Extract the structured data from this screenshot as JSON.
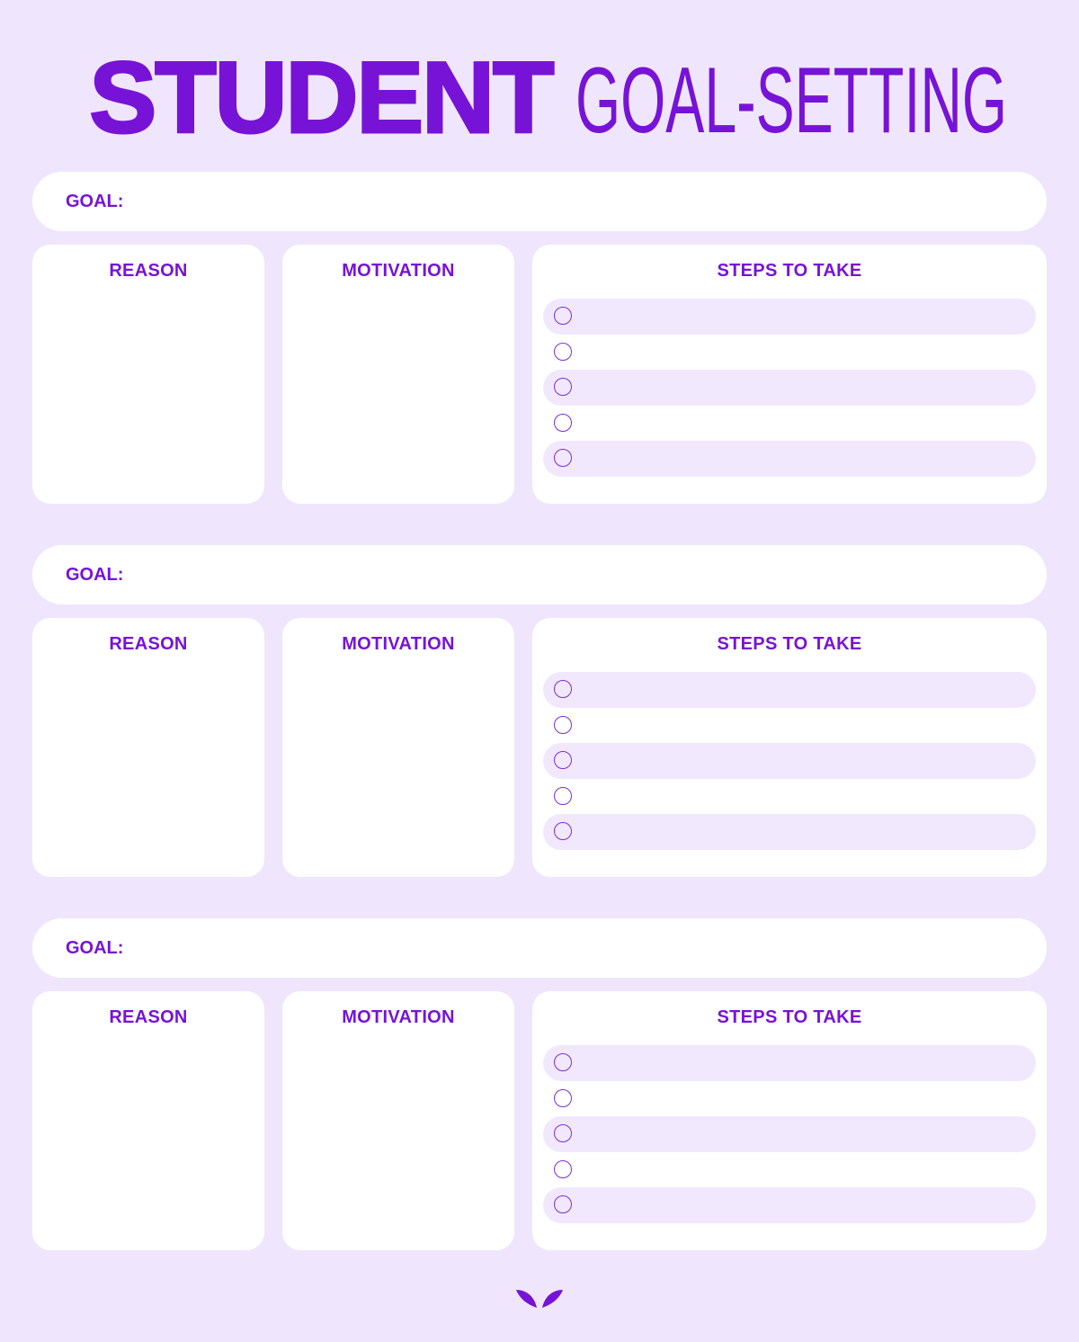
{
  "title": {
    "bold": "STUDENT",
    "light": "GOAL-SETTING"
  },
  "colors": {
    "accent": "#7713d6",
    "background": "#efe6fd",
    "card": "#ffffff",
    "row_shade": "#f1e8fd"
  },
  "sections": [
    {
      "goal_label": "GOAL:",
      "reason_label": "REASON",
      "motivation_label": "MOTIVATION",
      "steps_label": "STEPS TO TAKE",
      "steps": [
        "",
        "",
        "",
        "",
        ""
      ]
    },
    {
      "goal_label": "GOAL:",
      "reason_label": "REASON",
      "motivation_label": "MOTIVATION",
      "steps_label": "STEPS TO TAKE",
      "steps": [
        "",
        "",
        "",
        "",
        ""
      ]
    },
    {
      "goal_label": "GOAL:",
      "reason_label": "REASON",
      "motivation_label": "MOTIVATION",
      "steps_label": "STEPS TO TAKE",
      "steps": [
        "",
        "",
        "",
        "",
        ""
      ]
    }
  ],
  "footer": {
    "logo": "leaf-logo-icon"
  }
}
